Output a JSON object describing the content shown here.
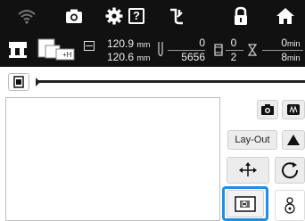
{
  "status": {
    "icons": [
      "wifi-icon",
      "camera-icon",
      "settings-gear-icon",
      "help-icon",
      "thread-path-icon",
      "lock-icon",
      "home-icon"
    ],
    "help_label": "?"
  },
  "info": {
    "width_value": "120.9",
    "height_value": "120.6",
    "unit_mm": "mm",
    "stitch_current": "0",
    "stitch_total": "5656",
    "color_current": "0",
    "color_total": "2",
    "time_current": "0",
    "time_total": "8",
    "unit_min": "min"
  },
  "buttons": {
    "layout_label": "Lay-Out"
  }
}
